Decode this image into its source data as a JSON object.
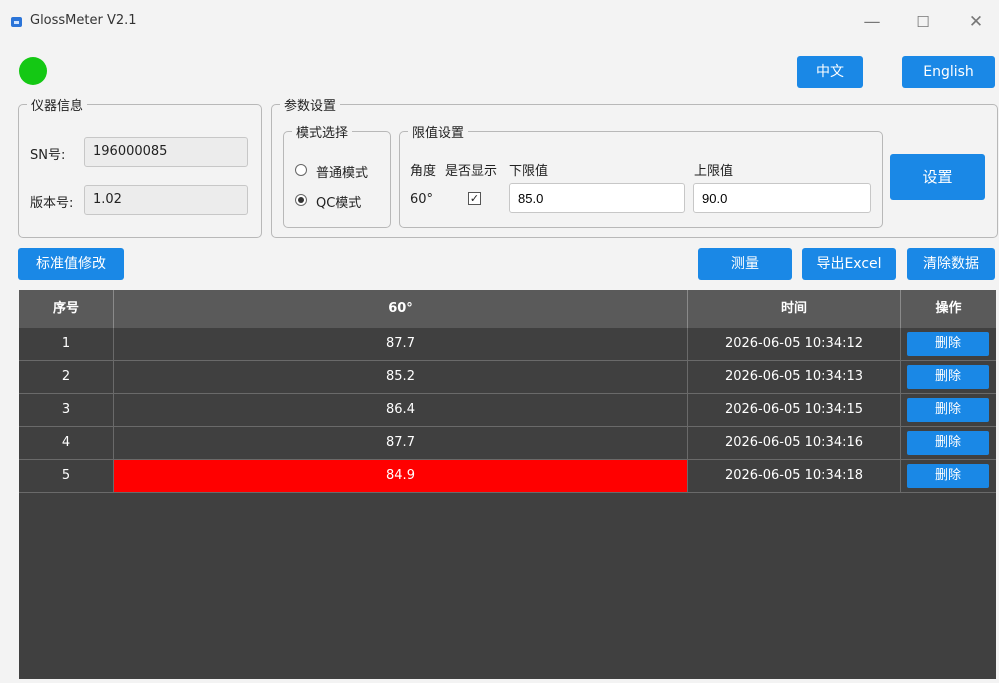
{
  "window": {
    "title": "GlossMeter V2.1",
    "icon": "app-icon",
    "controls": [
      "—",
      "☐",
      "✕"
    ]
  },
  "status": {
    "connected": true,
    "color": "#14c814"
  },
  "lang": {
    "chinese": "中文",
    "english": "English"
  },
  "device_info": {
    "legend": "仪器信息",
    "sn_label": "SN号:",
    "sn_value": "196000085",
    "version_label": "版本号:",
    "version_value": "1.02"
  },
  "params": {
    "legend": "参数设置",
    "mode": {
      "legend": "模式选择",
      "normal": "普通模式",
      "qc": "QC模式",
      "selected": "qc"
    },
    "limits": {
      "legend": "限值设置",
      "angle_header": "角度",
      "show_header": "是否显示",
      "lower_header": "下限值",
      "upper_header": "上限值",
      "angle": "60°",
      "show_checked": true,
      "lower": "85.0",
      "upper": "90.0"
    },
    "set_button": "设置"
  },
  "toolbar": {
    "std_modify": "标准值修改",
    "measure": "测量",
    "export": "导出Excel",
    "clear": "清除数据"
  },
  "table": {
    "headers": [
      "序号",
      "60°",
      "时间",
      "操作"
    ],
    "delete_label": "删除",
    "rows": [
      {
        "idx": "1",
        "value": "87.7",
        "time": "2026-06-05 10:34:12",
        "out_of_range": false
      },
      {
        "idx": "2",
        "value": "85.2",
        "time": "2026-06-05 10:34:13",
        "out_of_range": false
      },
      {
        "idx": "3",
        "value": "86.4",
        "time": "2026-06-05 10:34:15",
        "out_of_range": false
      },
      {
        "idx": "4",
        "value": "87.7",
        "time": "2026-06-05 10:34:16",
        "out_of_range": false
      },
      {
        "idx": "5",
        "value": "84.9",
        "time": "2026-06-05 10:34:18",
        "out_of_range": true
      }
    ]
  },
  "colors": {
    "accent": "#1a88e6",
    "table_bg": "#404040",
    "header_bg": "#5a5a5a",
    "alarm": "#ff0000"
  }
}
